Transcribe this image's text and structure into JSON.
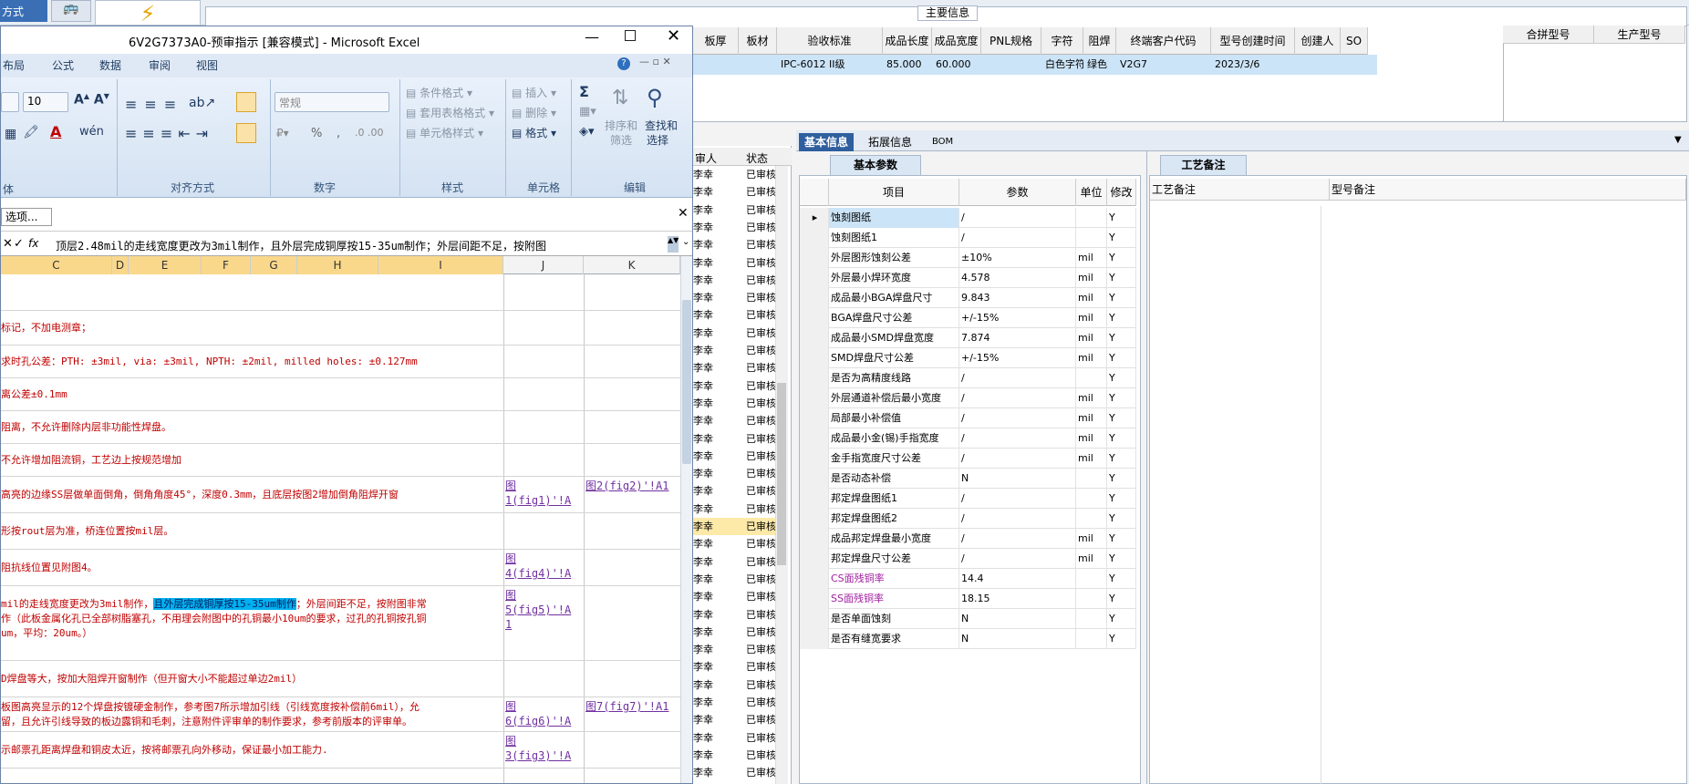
{
  "bg": {
    "tab_left": "方式",
    "tab_icon": "🚌",
    "bolt_icon": "⚡",
    "main_title": "主要信息",
    "main_headers": [
      "板厚",
      "板材",
      "验收标准",
      "成品长度",
      "成品宽度",
      "PNL规格",
      "字符",
      "阻焊",
      "终端客户代码",
      "型号创建时间",
      "创建人",
      "SO"
    ],
    "main_values": [
      "",
      "",
      "IPC-6012 II级",
      "85.000",
      "60.000",
      "",
      "白色字符",
      "绿色",
      "V2G7",
      "2023/3/6",
      "",
      ""
    ],
    "right_headers": [
      "合拼型号",
      "生产型号"
    ],
    "list_headers": [
      "审人",
      "状态"
    ],
    "list_rows_left": "李幸",
    "list_rows_right": "已审核",
    "tabs": [
      "基本信息",
      "拓展信息",
      "BOM"
    ],
    "param_tab": "基本参数",
    "craft_tab": "工艺备注",
    "craft_headers": [
      "工艺备注",
      "型号备注"
    ],
    "grid_headers": [
      "项目",
      "参数",
      "单位",
      "修改"
    ],
    "grid_rows": [
      {
        "item": "蚀刻图纸",
        "param": "/",
        "unit": "",
        "mod": "Y",
        "sel": true,
        "purple": false
      },
      {
        "item": "蚀刻图纸1",
        "param": "/",
        "unit": "",
        "mod": "Y",
        "sel": false,
        "purple": false
      },
      {
        "item": "外层图形蚀刻公差",
        "param": "±10%",
        "unit": "mil",
        "mod": "Y",
        "sel": false,
        "purple": false
      },
      {
        "item": "外层最小焊环宽度",
        "param": "4.578",
        "unit": "mil",
        "mod": "Y",
        "sel": false,
        "purple": false
      },
      {
        "item": "成品最小BGA焊盘尺寸",
        "param": "9.843",
        "unit": "mil",
        "mod": "Y",
        "sel": false,
        "purple": false
      },
      {
        "item": "BGA焊盘尺寸公差",
        "param": "+/-15%",
        "unit": "mil",
        "mod": "Y",
        "sel": false,
        "purple": false
      },
      {
        "item": "成品最小SMD焊盘宽度",
        "param": "7.874",
        "unit": "mil",
        "mod": "Y",
        "sel": false,
        "purple": false
      },
      {
        "item": "SMD焊盘尺寸公差",
        "param": "+/-15%",
        "unit": "mil",
        "mod": "Y",
        "sel": false,
        "purple": false
      },
      {
        "item": "是否为高精度线路",
        "param": "/",
        "unit": "",
        "mod": "Y",
        "sel": false,
        "purple": false
      },
      {
        "item": "外层通道补偿后最小宽度",
        "param": "/",
        "unit": "mil",
        "mod": "Y",
        "sel": false,
        "purple": false
      },
      {
        "item": "局部最小补偿值",
        "param": "/",
        "unit": "mil",
        "mod": "Y",
        "sel": false,
        "purple": false
      },
      {
        "item": "成品最小金(锡)手指宽度",
        "param": "/",
        "unit": "mil",
        "mod": "Y",
        "sel": false,
        "purple": false
      },
      {
        "item": "金手指宽度尺寸公差",
        "param": "/",
        "unit": "mil",
        "mod": "Y",
        "sel": false,
        "purple": false
      },
      {
        "item": "是否动态补偿",
        "param": "N",
        "unit": "",
        "mod": "Y",
        "sel": false,
        "purple": false
      },
      {
        "item": "邦定焊盘图纸1",
        "param": "/",
        "unit": "",
        "mod": "Y",
        "sel": false,
        "purple": false
      },
      {
        "item": "邦定焊盘图纸2",
        "param": "/",
        "unit": "",
        "mod": "Y",
        "sel": false,
        "purple": false
      },
      {
        "item": "成品邦定焊盘最小宽度",
        "param": "/",
        "unit": "mil",
        "mod": "Y",
        "sel": false,
        "purple": false
      },
      {
        "item": "邦定焊盘尺寸公差",
        "param": "/",
        "unit": "mil",
        "mod": "Y",
        "sel": false,
        "purple": false
      },
      {
        "item": "CS面残铜率",
        "param": "14.4",
        "unit": "",
        "mod": "Y",
        "sel": false,
        "purple": true
      },
      {
        "item": "SS面残铜率",
        "param": "18.15",
        "unit": "",
        "mod": "Y",
        "sel": false,
        "purple": true
      },
      {
        "item": "是否单面蚀刻",
        "param": "N",
        "unit": "",
        "mod": "Y",
        "sel": false,
        "purple": false
      },
      {
        "item": "是否有缝宽要求",
        "param": "N",
        "unit": "",
        "mod": "Y",
        "sel": false,
        "purple": false
      }
    ]
  },
  "excel": {
    "title": "6V2G7373A0-预审指示 [兼容模式] - Microsoft Excel",
    "ribbon_tabs": [
      "布局",
      "公式",
      "数据",
      "审阅",
      "视图"
    ],
    "font_size": "10",
    "number_format": "常规",
    "groups": [
      "体",
      "对齐方式",
      "数字",
      "样式",
      "单元格",
      "编辑"
    ],
    "style_items": [
      "条件格式",
      "套用表格格式",
      "单元格样式"
    ],
    "cell_items": [
      "插入",
      "删除",
      "格式"
    ],
    "edit_items": [
      "排序和筛选",
      "查找和选择"
    ],
    "sort_label": "排序和",
    "sort_label2": "筛选",
    "find_label": "查找和",
    "find_label2": "选择",
    "sigma": "Σ",
    "percent": "%",
    "comma": ",",
    "options_btn": "选项...",
    "formula": "顶层2.48mil的走线宽度更改为3mil制作，且外层完成铜厚按15-35um制作；外层间距不足，按附图",
    "fx": "fx",
    "columns": [
      "C",
      "D",
      "E",
      "F",
      "G",
      "H",
      "I",
      "J",
      "K"
    ],
    "rows": [
      {
        "text": "",
        "h": 40
      },
      {
        "text": "标记，不加电测章；",
        "h": 38
      },
      {
        "text": "求时孔公差：PTH: ±3mil, via: ±3mil, NPTH: ±2mil, milled holes: ±0.127mm",
        "h": 36
      },
      {
        "text": "离公差±0.1mm",
        "h": 36
      },
      {
        "text": "阻离，不允许删除内层非功能性焊盘。",
        "h": 36
      },
      {
        "text": "不允许增加阻流铜，工艺边上按规范增加",
        "h": 36
      },
      {
        "text": "高亮的边缘SS层做单面倒角，倒角角度45°，深度0.3mm，且底层按图2增加倒角阻焊开窗",
        "h": 40
      },
      {
        "text": "形按rout层为准，桥连位置按mil层。",
        "h": 40
      },
      {
        "text": "阻抗线位置见附图4。",
        "h": 40
      },
      {
        "text": "",
        "h": 82
      },
      {
        "text": "D焊盘等大，按加大阻焊开窗制作（但开窗大小不能超过单边2mil）",
        "h": 40
      },
      {
        "text": "板图高亮显示的12个焊盘按镀硬金制作，参考图7所示增加引线（引线宽度按补偿前6mil），允\n留，且允许引线导致的板边露铜和毛刺，注意附件评审单的制作要求，参考前版本的评审单。",
        "h": 38
      },
      {
        "text": "示邮票孔距离焊盘和铜皮太近，按将邮票孔向外移动，保证最小加工能力.",
        "h": 40
      }
    ],
    "row10_a": "mil的走线宽度更改为3mil制作，",
    "row10_hl": "且外层完成铜厚按15-35um制作",
    "row10_b": "；外层间距不足，按附图非常",
    "row10_c": "作（此板金属化孔已全部树脂塞孔，不用理会附图中的孔铜最小10um的要求，过孔的孔铜按孔铜",
    "row10_d": "um，平均：20um。）",
    "links": [
      {
        "row": 6,
        "col": "J",
        "text": "图\n1(fig1)'!A"
      },
      {
        "row": 6,
        "col": "K",
        "text": "图2(fig2)'!A1"
      },
      {
        "row": 8,
        "col": "J",
        "text": "图\n4(fig4)'!A"
      },
      {
        "row": 9,
        "col": "J",
        "text": "图\n5(fig5)'!A\n1"
      },
      {
        "row": 11,
        "col": "J",
        "text": "图\n6(fig6)'!A"
      },
      {
        "row": 11,
        "col": "K",
        "text": "图7(fig7)'!A1"
      },
      {
        "row": 12,
        "col": "J",
        "text": "图\n3(fig3)'!A"
      }
    ]
  }
}
